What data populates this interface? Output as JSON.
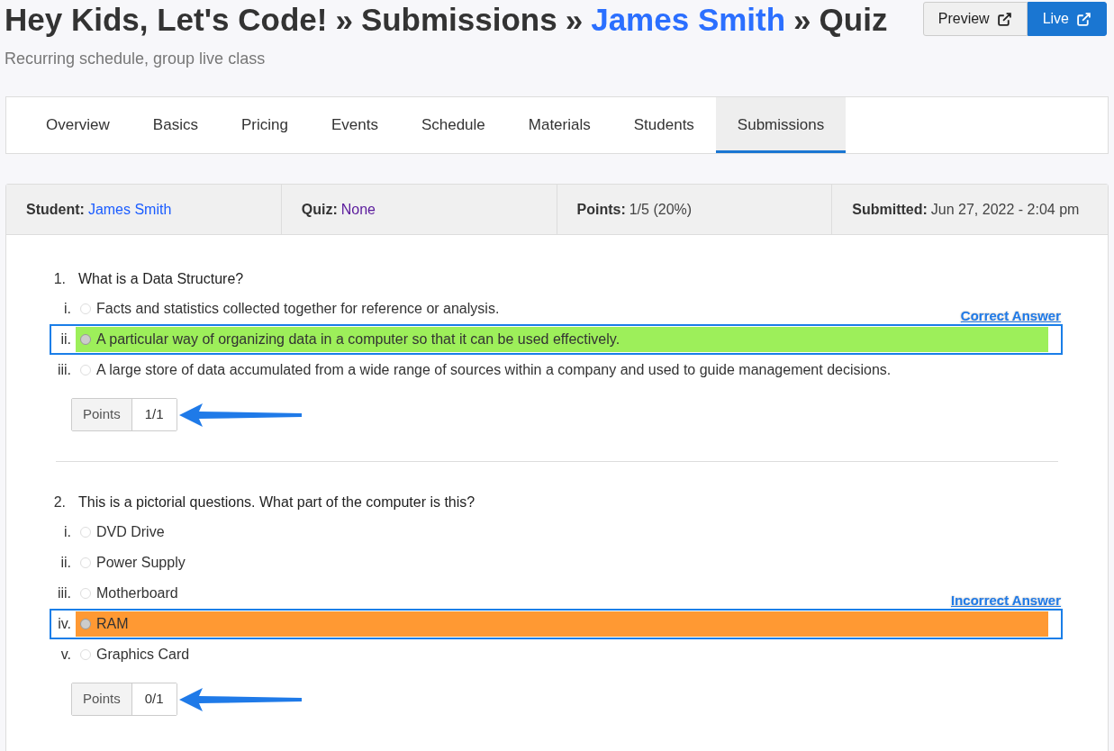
{
  "breadcrumb": [
    {
      "text": "Hey Kids, Let's Code!",
      "link": false
    },
    {
      "text": "Submissions",
      "link": false
    },
    {
      "text": "James Smith",
      "link": true
    },
    {
      "text": "Quiz",
      "link": false
    }
  ],
  "separator": "»",
  "subtitle": "Recurring schedule, group live class",
  "buttons": [
    {
      "label": "Preview",
      "primary": false
    },
    {
      "label": "Live",
      "primary": true
    }
  ],
  "tabs": [
    {
      "label": "Overview",
      "selected": false
    },
    {
      "label": "Basics",
      "selected": false
    },
    {
      "label": "Pricing",
      "selected": false
    },
    {
      "label": "Events",
      "selected": false
    },
    {
      "label": "Schedule",
      "selected": false
    },
    {
      "label": "Materials",
      "selected": false
    },
    {
      "label": "Students",
      "selected": false
    },
    {
      "label": "Submissions",
      "selected": true
    }
  ],
  "summary": [
    {
      "label": "Student:",
      "value": "James Smith",
      "color": "#1a5cff"
    },
    {
      "label": "Quiz:",
      "value": "None",
      "color": "#5a1a9c"
    },
    {
      "label": "Points:",
      "value": "1/5 (20%)",
      "color": "#444444"
    },
    {
      "label": "Submitted:",
      "value": "Jun 27, 2022 - 2:04 pm",
      "color": "#444444"
    }
  ],
  "questions": [
    {
      "number": "1.",
      "text": "What is a Data Structure?",
      "options": [
        {
          "numeral": "i.",
          "text": "Facts and statistics collected together for reference or analysis.",
          "selected": false,
          "kind": "plain"
        },
        {
          "numeral": "ii.",
          "text": "A particular way of organizing data in a computer so that it can be used effectively.",
          "selected": true,
          "kind": "correct",
          "annotation": "Correct Answer"
        },
        {
          "numeral": "iii.",
          "text": "A large store of data accumulated from a wide range of sources within a company and used to guide management decisions.",
          "selected": false,
          "kind": "plain"
        }
      ],
      "points_label": "Points",
      "points": "1/1"
    },
    {
      "number": "2.",
      "text": "This is a pictorial questions. What part of the computer is this?",
      "options": [
        {
          "numeral": "i.",
          "text": "DVD Drive",
          "selected": false,
          "kind": "plain"
        },
        {
          "numeral": "ii.",
          "text": "Power Supply",
          "selected": false,
          "kind": "plain"
        },
        {
          "numeral": "iii.",
          "text": "Motherboard",
          "selected": false,
          "kind": "plain"
        },
        {
          "numeral": "iv.",
          "text": "RAM",
          "selected": true,
          "kind": "incorrect",
          "annotation": "Incorrect Answer"
        },
        {
          "numeral": "v.",
          "text": "Graphics Card",
          "selected": false,
          "kind": "plain"
        }
      ],
      "points_label": "Points",
      "points": "0/1"
    }
  ]
}
